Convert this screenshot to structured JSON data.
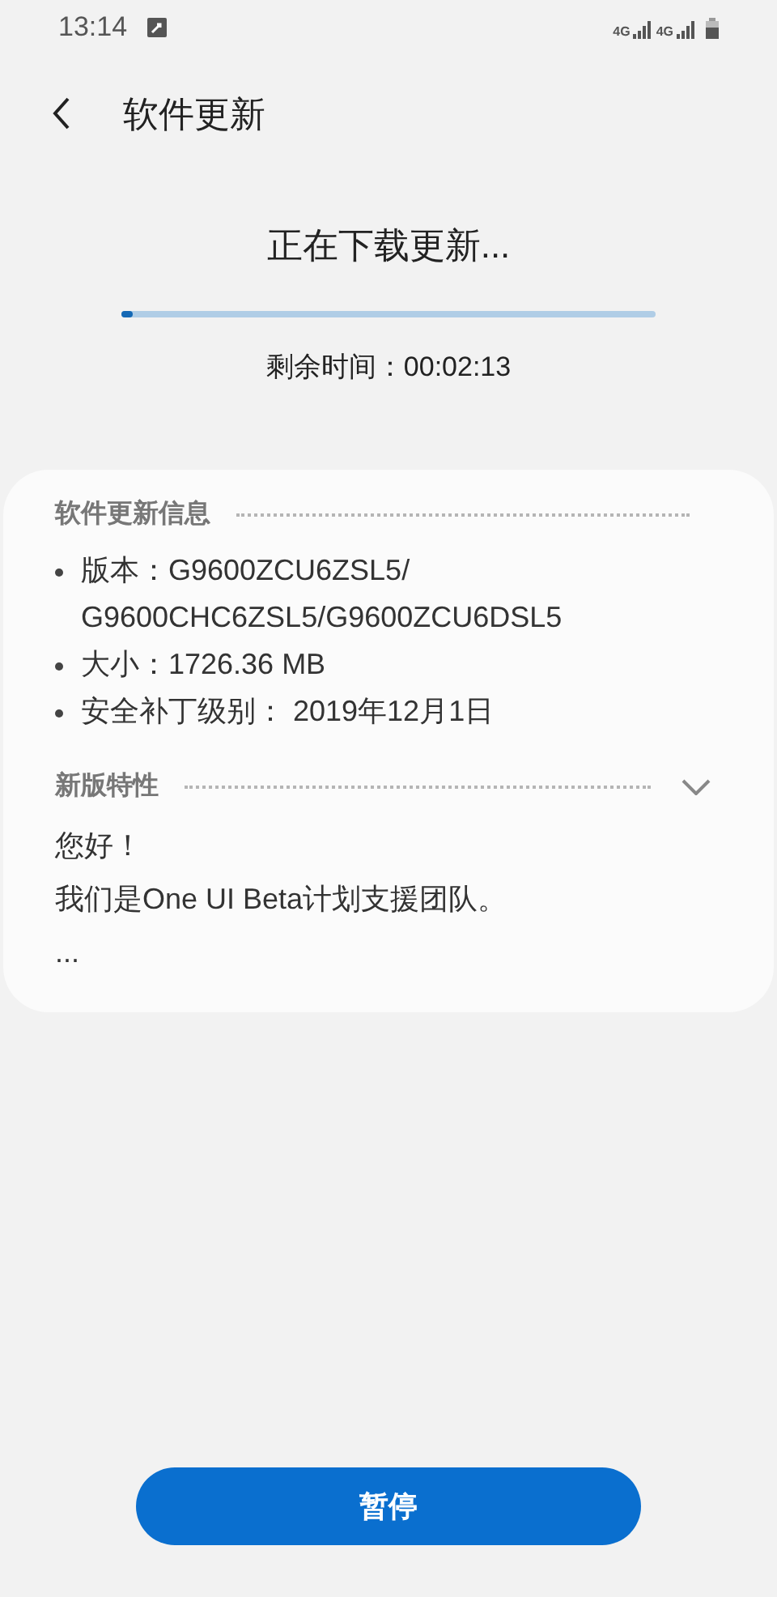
{
  "status_bar": {
    "time": "13:14",
    "network_1": "4G",
    "network_2": "4G"
  },
  "header": {
    "title": "软件更新"
  },
  "download": {
    "title": "正在下载更新...",
    "level": 0.02,
    "remaining": "剩余时间：00:02:13"
  },
  "info": {
    "heading": "软件更新信息",
    "items": [
      {
        "text": "版本：G9600ZCU6ZSL5/ G9600CHC6ZSL5/G9600ZCU6DSL5"
      },
      {
        "text": "大小：1726.36 MB"
      },
      {
        "text": "安全补丁级别： 2019年12月1日"
      }
    ]
  },
  "features": {
    "heading": "新版特性",
    "expanded": false,
    "lines": [
      "您好！",
      "我们是One UI Beta计划支援团队。",
      "..."
    ]
  },
  "pause_button": {
    "label": "暂停"
  }
}
